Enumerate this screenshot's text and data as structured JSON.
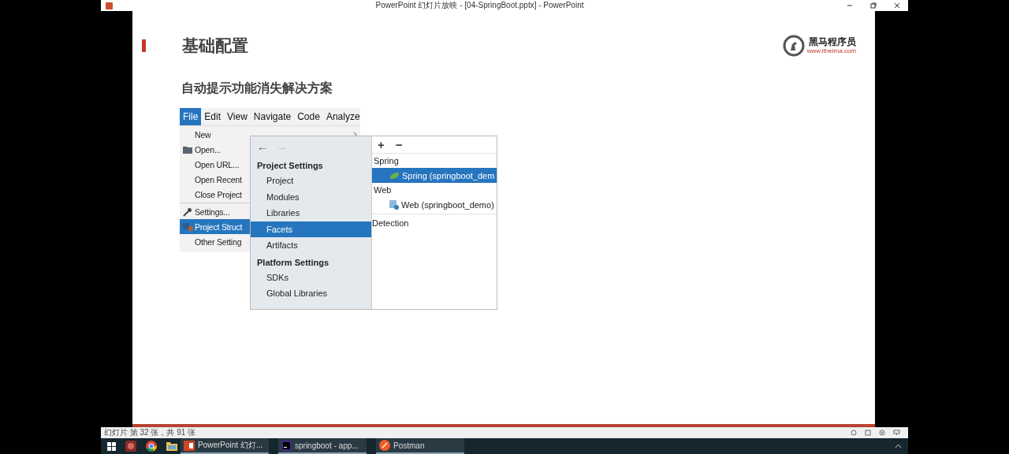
{
  "window": {
    "title": "PowerPoint 幻灯片放映 - [04-SpringBoot.pptx] - PowerPoint"
  },
  "slide": {
    "title": "基础配置",
    "logo": {
      "name": "黑马程序员",
      "url": "www.itheima.com"
    },
    "subtitle": "自动提示功能消失解决方案",
    "screenshot": {
      "menu_bar": [
        {
          "label": "File",
          "selected": true
        },
        {
          "label": "Edit",
          "selected": false
        },
        {
          "label": "View",
          "selected": false
        },
        {
          "label": "Navigate",
          "selected": false
        },
        {
          "label": "Code",
          "selected": false
        },
        {
          "label": "Analyze",
          "selected": false
        }
      ],
      "file_menu": [
        {
          "label": "New",
          "kind": "submenu",
          "selected": false,
          "separator_before": false
        },
        {
          "label": "Open...",
          "kind": "folder",
          "selected": false,
          "separator_before": false
        },
        {
          "label": "Open URL...",
          "kind": "plain",
          "selected": false,
          "separator_before": false
        },
        {
          "label": "Open Recent",
          "kind": "plain",
          "selected": false,
          "separator_before": false
        },
        {
          "label": "Close Project",
          "kind": "plain",
          "selected": false,
          "separator_before": false
        },
        {
          "label": "Settings...",
          "kind": "wrench",
          "selected": false,
          "separator_before": true
        },
        {
          "label": "Project Struct",
          "kind": "project",
          "selected": true,
          "separator_before": false
        },
        {
          "label": "Other Setting",
          "kind": "plain",
          "selected": false,
          "separator_before": false
        }
      ],
      "dialog": {
        "back": {
          "label": "←",
          "disabled": false
        },
        "forward": {
          "label": "→",
          "disabled": true
        },
        "sections": [
          {
            "heading": "Project Settings",
            "items": [
              {
                "label": "Project",
                "selected": false
              },
              {
                "label": "Modules",
                "selected": false
              },
              {
                "label": "Libraries",
                "selected": false
              },
              {
                "label": "Facets",
                "selected": true
              },
              {
                "label": "Artifacts",
                "selected": false
              }
            ]
          },
          {
            "heading": "Platform Settings",
            "items": [
              {
                "label": "SDKs",
                "selected": false
              },
              {
                "label": "Global Libraries",
                "selected": false
              }
            ]
          }
        ],
        "toolbar": [
          "+",
          "−"
        ],
        "tree": [
          {
            "label": "Spring",
            "children": [
              {
                "label": "Spring (springboot_dem",
                "kind": "spring",
                "selected": true
              }
            ]
          },
          {
            "label": "Web",
            "children": [
              {
                "label": "Web (springboot_demo)",
                "kind": "web",
                "selected": false
              }
            ]
          }
        ],
        "detection": "Detection"
      }
    }
  },
  "status_bar": {
    "text": "幻灯片 第 32 张，共 91 张"
  },
  "taskbar": {
    "apps": [
      {
        "label": "PowerPoint 幻灯...",
        "kind": "powerpoint"
      },
      {
        "label": "springboot - app...",
        "kind": "intellij"
      },
      {
        "label": "Postman",
        "kind": "postman"
      }
    ]
  }
}
